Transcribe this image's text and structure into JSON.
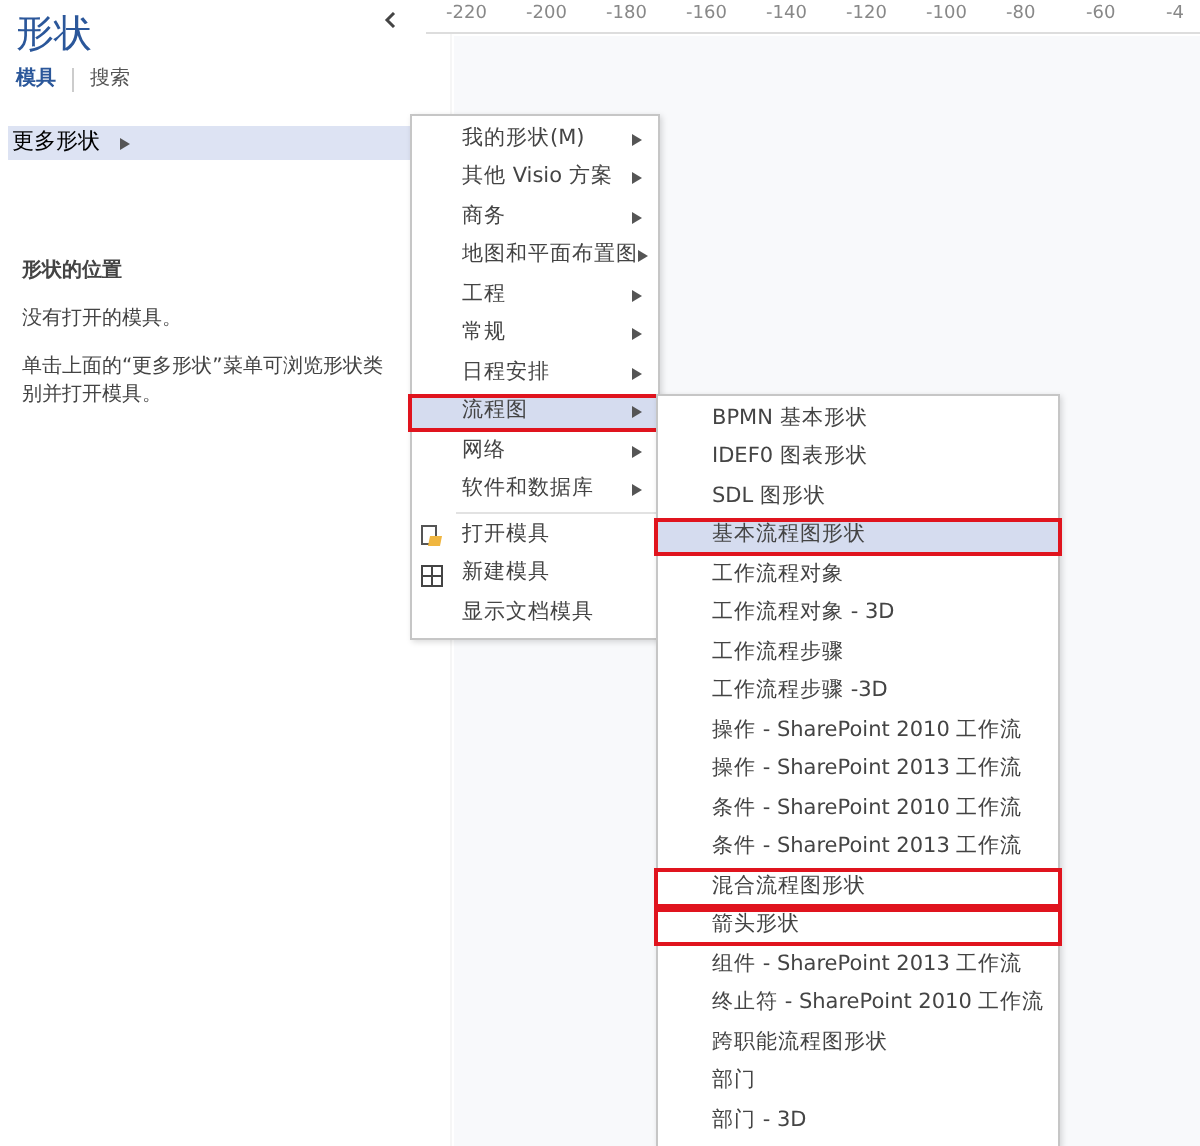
{
  "panel": {
    "title": "形状",
    "tabs": [
      {
        "label": "模具",
        "selected": true
      },
      {
        "label": "搜索",
        "selected": false
      }
    ],
    "more_shapes": {
      "label": "更多形状",
      "selected": true
    },
    "section_title": "形状的位置",
    "empty_message": "没有打开的模具。",
    "hint": "单击上面的“更多形状”菜单可浏览形状类别并打开模具。"
  },
  "ruler": {
    "horizontal_labels": [
      "-220",
      "-200",
      "-180",
      "-160",
      "-140",
      "-120",
      "-100",
      "-80",
      "-60",
      "-4"
    ]
  },
  "menu": {
    "items": [
      {
        "label": "我的形状(M)",
        "kind": "submenu",
        "selected": false,
        "annotated": false
      },
      {
        "label": "其他 Visio 方案",
        "kind": "submenu",
        "selected": false,
        "annotated": false
      },
      {
        "label": "商务",
        "kind": "submenu",
        "selected": false,
        "annotated": false
      },
      {
        "label": "地图和平面布置图",
        "kind": "submenu",
        "selected": false,
        "annotated": false
      },
      {
        "label": "工程",
        "kind": "submenu",
        "selected": false,
        "annotated": false
      },
      {
        "label": "常规",
        "kind": "submenu",
        "selected": false,
        "annotated": false
      },
      {
        "label": "日程安排",
        "kind": "submenu",
        "selected": false,
        "annotated": false
      },
      {
        "label": "流程图",
        "kind": "submenu",
        "selected": true,
        "annotated": true
      },
      {
        "label": "网络",
        "kind": "submenu",
        "selected": false,
        "annotated": false
      },
      {
        "label": "软件和数据库",
        "kind": "submenu",
        "selected": false,
        "annotated": false
      },
      {
        "label": "打开模具",
        "kind": "open",
        "selected": false,
        "annotated": false
      },
      {
        "label": "新建模具",
        "kind": "new",
        "selected": false,
        "annotated": false
      },
      {
        "label": "显示文档模具",
        "kind": "plain",
        "selected": false,
        "annotated": false
      }
    ]
  },
  "submenu": {
    "items": [
      {
        "label": "BPMN 基本形状",
        "selected": false,
        "annotated": false
      },
      {
        "label": "IDEF0 图表形状",
        "selected": false,
        "annotated": false
      },
      {
        "label": "SDL 图形状",
        "selected": false,
        "annotated": false
      },
      {
        "label": "基本流程图形状",
        "selected": true,
        "annotated": true
      },
      {
        "label": "工作流程对象",
        "selected": false,
        "annotated": false
      },
      {
        "label": "工作流程对象 - 3D",
        "selected": false,
        "annotated": false
      },
      {
        "label": "工作流程步骤",
        "selected": false,
        "annotated": false
      },
      {
        "label": "工作流程步骤 -3D",
        "selected": false,
        "annotated": false
      },
      {
        "label": "操作 - SharePoint 2010 工作流",
        "selected": false,
        "annotated": false
      },
      {
        "label": "操作 - SharePoint 2013 工作流",
        "selected": false,
        "annotated": false
      },
      {
        "label": "条件 - SharePoint 2010 工作流",
        "selected": false,
        "annotated": false
      },
      {
        "label": "条件 - SharePoint 2013 工作流",
        "selected": false,
        "annotated": false
      },
      {
        "label": "混合流程图形状",
        "selected": false,
        "annotated": true
      },
      {
        "label": "箭头形状",
        "selected": false,
        "annotated": true
      },
      {
        "label": "组件 - SharePoint 2013 工作流",
        "selected": false,
        "annotated": false
      },
      {
        "label": "终止符 - SharePoint 2010 工作流",
        "selected": false,
        "annotated": false
      },
      {
        "label": "跨职能流程图形状",
        "selected": false,
        "annotated": false
      },
      {
        "label": "部门",
        "selected": false,
        "annotated": false
      },
      {
        "label": "部门 - 3D",
        "selected": false,
        "annotated": false
      }
    ]
  }
}
